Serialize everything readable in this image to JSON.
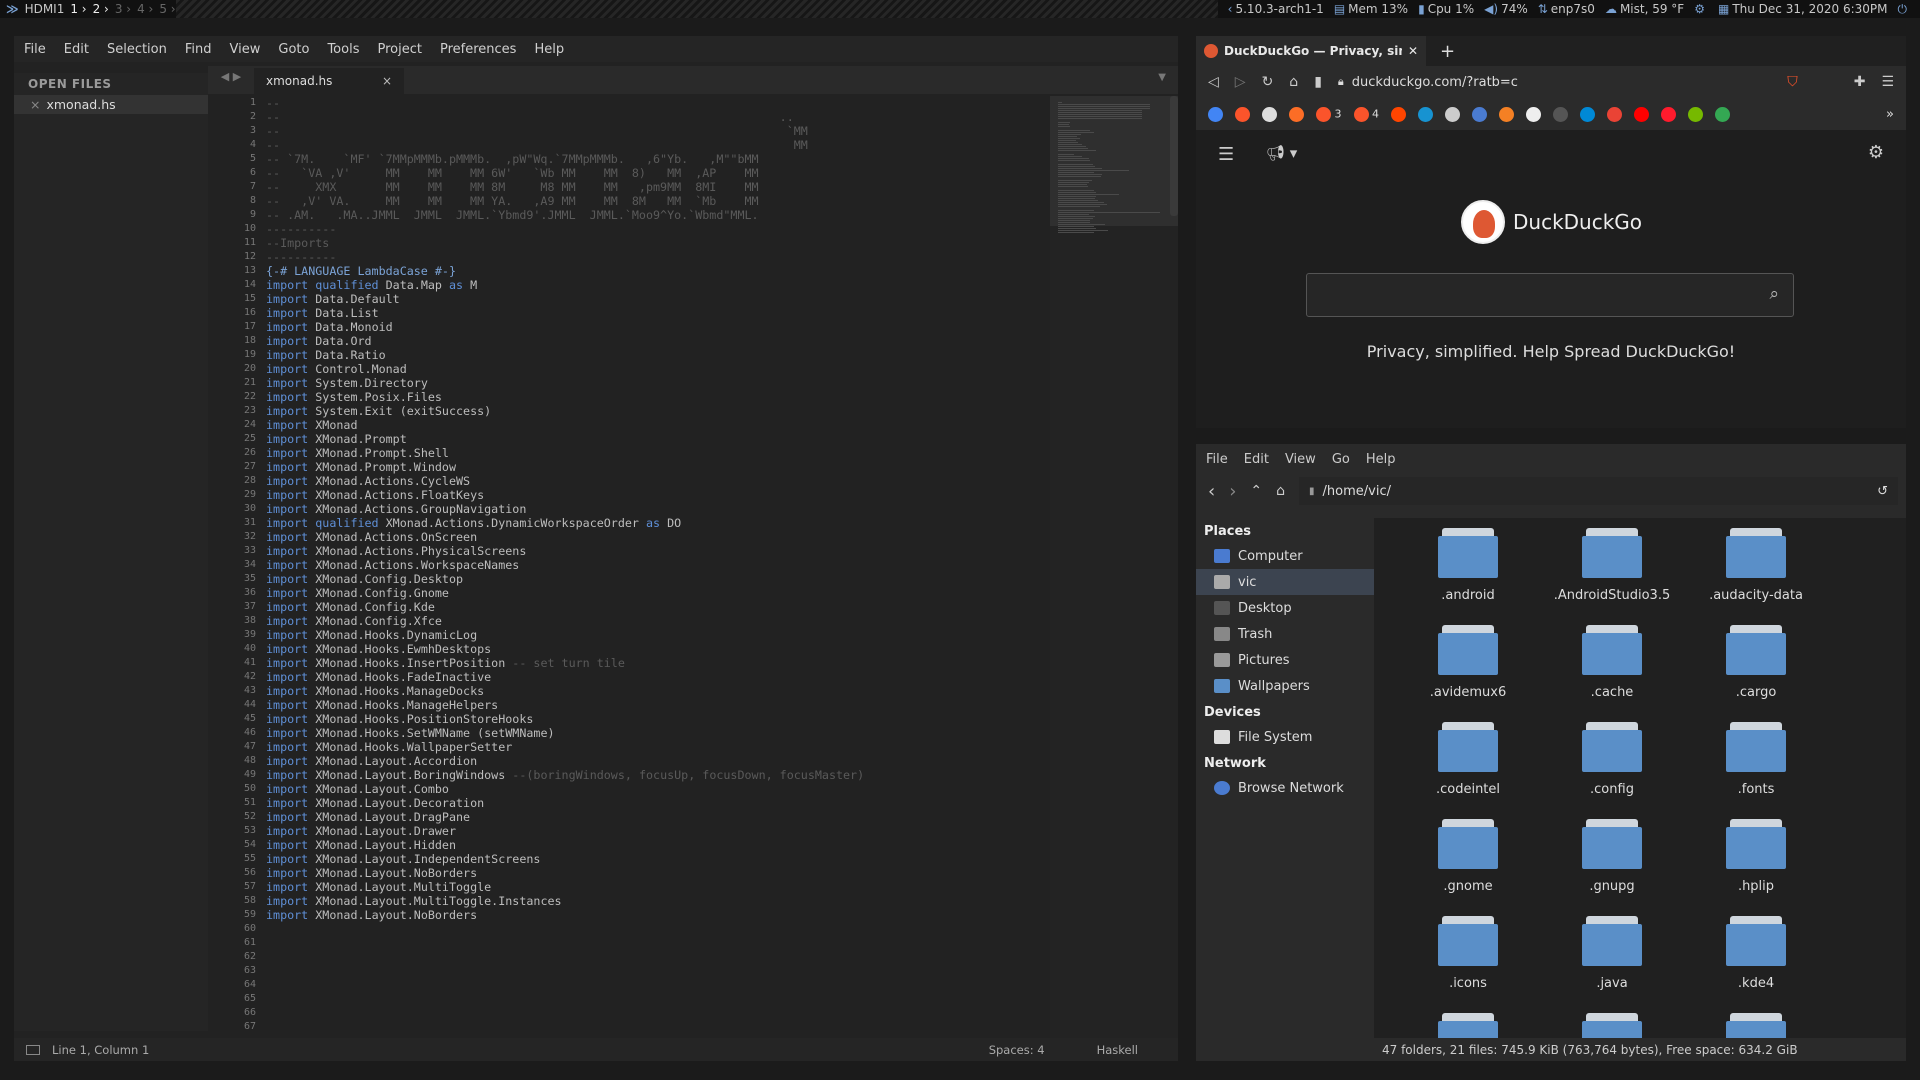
{
  "topbar": {
    "logo": "≫",
    "layout": "HDMI1",
    "workspaces": [
      {
        "label": "1 ›",
        "active": true
      },
      {
        "label": "2 ›",
        "active": true
      },
      {
        "label": "3 ›",
        "active": false
      },
      {
        "label": "4 ›",
        "active": false
      },
      {
        "label": "5 ›",
        "active": false
      }
    ],
    "kernel": "5.10.3-arch1-1",
    "mem": "Mem 13%",
    "cpu": "Cpu   1%",
    "volume": "74%",
    "net": "enp7s0",
    "weather": "Mist, 59 °F",
    "datetime": "Thu Dec 31, 2020  6:30PM"
  },
  "editor": {
    "menu": [
      "File",
      "Edit",
      "Selection",
      "Find",
      "View",
      "Goto",
      "Tools",
      "Project",
      "Preferences",
      "Help"
    ],
    "sidebar_title": "OPEN FILES",
    "open_file": "xmonad.hs",
    "tab_label": "xmonad.hs",
    "status_position": "Line 1, Column 1",
    "status_spaces": "Spaces: 4",
    "status_syntax": "Haskell",
    "lines": [
      {
        "n": "1",
        "c": ""
      },
      {
        "n": "2",
        "c": "-- "
      },
      {
        "n": "3",
        "c": "--                                                                       ..  "
      },
      {
        "n": "4",
        "c": "--                                                                        `MM"
      },
      {
        "n": "5",
        "c": "--                                                                         MM"
      },
      {
        "n": "6",
        "c": "-- `7M.    `MF' `7MMpMMMb.pMMMb.  ,pW\"Wq.`7MMpMMMb.   ,6\"Yb.   ,M\"\"bMM"
      },
      {
        "n": "7",
        "c": "--   `VA ,V'     MM    MM    MM 6W'   `Wb MM    MM  8)   MM  ,AP    MM"
      },
      {
        "n": "8",
        "c": "--     XMX       MM    MM    MM 8M     M8 MM    MM   ,pm9MM  8MI    MM"
      },
      {
        "n": "9",
        "c": "--   ,V' VA.     MM    MM    MM YA.   ,A9 MM    MM  8M   MM  `Mb    MM"
      },
      {
        "n": "10",
        "c": "-- .AM.   .MA..JMML  JMML  JMML.`Ybmd9'.JMML  JMML.`Moo9^Yo.`Wbmd\"MML."
      },
      {
        "n": "11",
        "c": ""
      },
      {
        "n": "12",
        "c": "----------"
      },
      {
        "n": "13",
        "c": "--Imports"
      },
      {
        "n": "14",
        "c": "----------"
      },
      {
        "n": "15",
        "c": ""
      },
      {
        "n": "16",
        "c": "{-# LANGUAGE LambdaCase #-}"
      },
      {
        "n": "17",
        "c": "import qualified Data.Map as M"
      },
      {
        "n": "18",
        "c": "import Data.Default"
      },
      {
        "n": "19",
        "c": "import Data.List"
      },
      {
        "n": "20",
        "c": "import Data.Monoid"
      },
      {
        "n": "21",
        "c": "import Data.Ord"
      },
      {
        "n": "22",
        "c": "import Data.Ratio"
      },
      {
        "n": "23",
        "c": "import Control.Monad"
      },
      {
        "n": "24",
        "c": "import System.Directory"
      },
      {
        "n": "25",
        "c": "import System.Posix.Files"
      },
      {
        "n": "26",
        "c": "import System.Exit (exitSuccess)"
      },
      {
        "n": "27",
        "c": ""
      },
      {
        "n": "28",
        "c": "import XMonad"
      },
      {
        "n": "29",
        "c": "import XMonad.Prompt"
      },
      {
        "n": "30",
        "c": "import XMonad.Prompt.Shell"
      },
      {
        "n": "31",
        "c": "import XMonad.Prompt.Window"
      },
      {
        "n": "32",
        "c": ""
      },
      {
        "n": "33",
        "c": "import XMonad.Actions.CycleWS"
      },
      {
        "n": "34",
        "c": "import XMonad.Actions.FloatKeys"
      },
      {
        "n": "35",
        "c": "import XMonad.Actions.GroupNavigation"
      },
      {
        "n": "36",
        "c": "import qualified XMonad.Actions.DynamicWorkspaceOrder as DO"
      },
      {
        "n": "37",
        "c": "import XMonad.Actions.OnScreen"
      },
      {
        "n": "38",
        "c": "import XMonad.Actions.PhysicalScreens"
      },
      {
        "n": "39",
        "c": "import XMonad.Actions.WorkspaceNames"
      },
      {
        "n": "40",
        "c": ""
      },
      {
        "n": "41",
        "c": "import XMonad.Config.Desktop"
      },
      {
        "n": "42",
        "c": "import XMonad.Config.Gnome"
      },
      {
        "n": "43",
        "c": "import XMonad.Config.Kde"
      },
      {
        "n": "44",
        "c": "import XMonad.Config.Xfce"
      },
      {
        "n": "45",
        "c": ""
      },
      {
        "n": "46",
        "c": "import XMonad.Hooks.DynamicLog"
      },
      {
        "n": "47",
        "c": "import XMonad.Hooks.EwmhDesktops"
      },
      {
        "n": "48",
        "c": "import XMonad.Hooks.InsertPosition -- set turn tile"
      },
      {
        "n": "49",
        "c": "import XMonad.Hooks.FadeInactive"
      },
      {
        "n": "50",
        "c": "import XMonad.Hooks.ManageDocks"
      },
      {
        "n": "51",
        "c": "import XMonad.Hooks.ManageHelpers"
      },
      {
        "n": "52",
        "c": "import XMonad.Hooks.PositionStoreHooks"
      },
      {
        "n": "53",
        "c": "import XMonad.Hooks.SetWMName (setWMName)"
      },
      {
        "n": "54",
        "c": "import XMonad.Hooks.WallpaperSetter"
      },
      {
        "n": "55",
        "c": ""
      },
      {
        "n": "56",
        "c": "import XMonad.Layout.Accordion"
      },
      {
        "n": "57",
        "c": "import XMonad.Layout.BoringWindows --(boringWindows, focusUp, focusDown, focusMaster)"
      },
      {
        "n": "58",
        "c": "import XMonad.Layout.Combo"
      },
      {
        "n": "59",
        "c": "import XMonad.Layout.Decoration"
      },
      {
        "n": "60",
        "c": "import XMonad.Layout.DragPane"
      },
      {
        "n": "61",
        "c": "import XMonad.Layout.Drawer"
      },
      {
        "n": "62",
        "c": "import XMonad.Layout.Hidden"
      },
      {
        "n": "63",
        "c": "import XMonad.Layout.IndependentScreens"
      },
      {
        "n": "64",
        "c": "import XMonad.Layout.NoBorders"
      },
      {
        "n": "65",
        "c": "import XMonad.Layout.MultiToggle"
      },
      {
        "n": "66",
        "c": "import XMonad.Layout.MultiToggle.Instances"
      },
      {
        "n": "67",
        "c": "import XMonad.Layout.NoBorders"
      }
    ]
  },
  "browser": {
    "tab_title": "DuckDuckGo — Privacy, sim",
    "url": "duckduckgo.com/?ratb=c",
    "bookmark_counts": [
      "3",
      "4"
    ],
    "brand": "DuckDuckGo",
    "search_placeholder": "",
    "tagline": "Privacy, simplified. Help Spread DuckDuckGo!"
  },
  "filemanager": {
    "menu": [
      "File",
      "Edit",
      "View",
      "Go",
      "Help"
    ],
    "path": "/home/vic/",
    "places_title": "Places",
    "places": [
      "Computer",
      "vic",
      "Desktop",
      "Trash",
      "Pictures",
      "Wallpapers"
    ],
    "devices_title": "Devices",
    "devices": [
      "File System"
    ],
    "network_title": "Network",
    "network": [
      "Browse Network"
    ],
    "folders": [
      ".android",
      ".AndroidStudio3.5",
      ".audacity-data",
      ".avidemux6",
      ".cache",
      ".cargo",
      ".codeintel",
      ".config",
      ".fonts",
      ".gnome",
      ".gnupg",
      ".hplip",
      ".icons",
      ".java",
      ".kde4",
      "",
      "",
      ""
    ],
    "status": "47 folders, 21 files: 745.9 KiB (763,764 bytes), Free space: 634.2 GiB"
  },
  "colors": {
    "accent": "#5a8fc8",
    "keyword": "#5f8fd6",
    "ddg_orange": "#de5833"
  }
}
